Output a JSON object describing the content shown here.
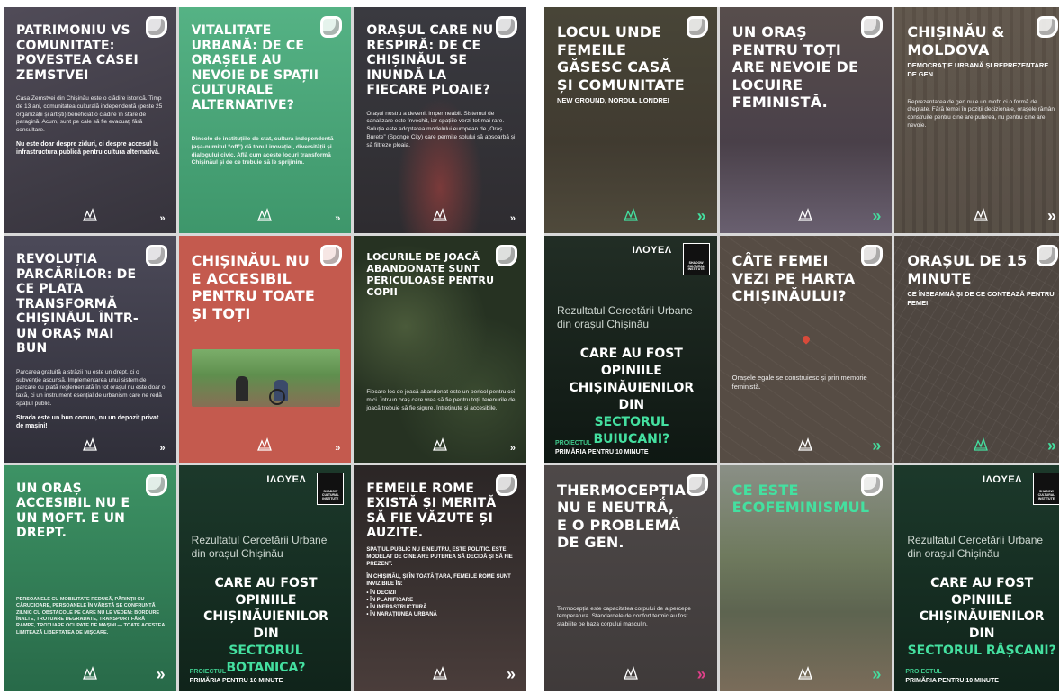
{
  "left_panel": {
    "tiles": [
      {
        "title": "PATRIMONIU VS COMUNITATE: POVESTEA CASEI ZEMSTVEI",
        "body": "Casa Zemstvei din Chișinău este o clădire istorică. Timp de 13 ani, comunitatea culturală independentă (peste 25 organizații și artiști) beneficiat o clădire în stare de paragină. Acum, sunt pe cale să fie evacuați fără consultare.",
        "strong": "Nu este doar despre ziduri, ci despre accesul la infrastructura publică pentru cultura alternativă.",
        "arrow": "»",
        "bg": "#4a4650"
      },
      {
        "title": "VITALITATE URBANĂ: DE CE ORAȘELE AU NEVOIE DE SPAȚII CULTURALE ALTERNATIVE?",
        "body": "Dincolo de instituțiile de stat, cultura independentă (așa-numitul “off”) dă tonul inovației, diversității și dialogului civic. Află cum aceste locuri transformă Chișinăul și de ce trebuie să le sprijinim.",
        "arrow": "»",
        "bg": "#4cae7e"
      },
      {
        "title": "ORAȘUL CARE NU RESPIRĂ: DE CE CHIȘINĂUL SE INUNDĂ LA FIECARE PLOAIE?",
        "body": "Orașul nostru a devenit impermeabil. Sistemul de canalizare este învechit, iar spațiile verzi tot mai rare. Soluția este adoptarea modelului european de „Oraș Burete” (Sponge City) care permite solului să absoarbă și să filtreze ploaia.",
        "arrow": "»",
        "bg": "#3e3d45"
      },
      {
        "title": "REVOLUȚIA PARCĂRILOR: DE CE PLATA TRANSFORMĂ CHIȘINĂUL ÎNTR-UN ORAȘ MAI BUN",
        "body": "Parcarea gratuită a străzii nu este un drept, ci o subvenție ascunsă. Implementarea unui sistem de parcare cu plată reglementată în tot orașul nu este doar o taxă, ci un instrument esențial de urbanism care ne redă spațiul public.",
        "strong": "Strada este un bun comun, nu un depozit privat de mașini!",
        "arrow": "»",
        "bg": "#4a4856"
      },
      {
        "title": "CHIȘINĂUL NU E ACCESIBIL PENTRU TOATE ȘI TOȚI",
        "arrow": "»",
        "bg": "#c45a4e"
      },
      {
        "title": "LOCURILE DE JOACĂ ABANDONATE SUNT PERICULOASE PENTRU COPII",
        "body": "Fiecare loc de joacă abandonat este un pericol pentru cei mici. Într-un oraș care vrea să fie pentru toți, terenurile de joacă trebuie să fie sigure, întreținute și accesibile.",
        "arrow": "»",
        "bg": "#2f3c2c"
      },
      {
        "title": "UN ORAȘ ACCESIBIL NU E UN MOFT. E UN DREPT.",
        "body": "PERSOANELE CU MOBILITATE REDUSĂ, PĂRINȚII CU CĂRUCIOARE, PERSOANELE ÎN VÂRSTĂ SE CONFRUNTĂ ZILNIC CU OBSTACOLE PE CARE NU LE VEDEM: BORDURE ÎNALTE, TROTUARE DEGRADATE, TRANSPORT FĂRĂ RAMPE, TROTUARE OCUPATE DE MAȘINI — TOATE ACESTEA LIMITEAZĂ LIBERTATEA DE MIȘCARE.",
        "arrow": "»",
        "bg": "#3f8e66"
      },
      {
        "survey": true,
        "brand": "ΙΛOΥΕΛ",
        "badge": "SHADOW CULTURAL INSTITUTE",
        "kicker": "Rezultatul Cercetării Urbane din orașul Chișinău",
        "question": "CARE AU FOST OPINIILE CHIȘINĂUIENILOR DIN",
        "sector": "SECTORUL BOTANICA?",
        "foot1": "PROIECTUL",
        "foot2": "PRIMĂRIA PENTRU 10 MINUTE",
        "bg": "#1e3d2e"
      },
      {
        "title": "FEMEILE ROME EXISTĂ ȘI MERITĂ SĂ FIE VĂZUTE ȘI AUZITE.",
        "body": "SPAȚIUL PUBLIC NU E NEUTRU, ESTE POLITIC. ESTE MODELAT DE CINE ARE PUTEREA SĂ DECIDĂ ȘI SĂ FIE PREZENT.",
        "list_intro": "ÎN CHIȘINĂU, ȘI ÎN TOATĂ ȚARA, FEMEILE ROME SUNT INVIZIBILE ÎN:",
        "list": [
          "• ÎN DECIZII",
          "• ÎN PLANIFICARE",
          "• ÎN INFRASTRUCTURĂ",
          "• ÎN NARAȚIUNEA URBANĂ"
        ],
        "arrow": "»",
        "bg": "#3a3434"
      }
    ]
  },
  "right_panel": {
    "tiles": [
      {
        "title": "LOCUL UNDE FEMEILE GĂSESC CASĂ ȘI COMUNITATE",
        "subtitle": "NEW GROUND, NORDUL LONDREI",
        "arrow": "»",
        "arrow_color": "teal",
        "bg": "#4b4438"
      },
      {
        "title": "UN ORAȘ PENTRU TOȚI ARE NEVOIE DE LOCUIRE FEMINISTĂ.",
        "arrow": "»",
        "arrow_color": "teal",
        "bg": "#534a45"
      },
      {
        "title": "CHIȘINĂU & MOLDOVA",
        "subtitle": "DEMOCRAȚIE URBANĂ ȘI REPREZENTARE DE GEN",
        "body": "Reprezentarea de gen nu e un mofт, ci o formă de dreptate. Fără femei în poziții decizionale, orașele rămân construite pentru cine are puterea, nu pentru cine are nevoie.",
        "arrow": "»",
        "arrow_color": "white",
        "bg": "#5a5046"
      },
      {
        "survey": true,
        "brand": "ΙΛOΥΕΛ",
        "badge": "SHADOW CULTURAL INSTITUTE",
        "kicker": "Rezultatul Cercetării Urbane din orașul Chișinău",
        "question": "CARE AU FOST OPINIILE CHIȘINĂUIENILOR DIN",
        "sector": "SECTORUL BUIUCANI?",
        "foot1": "PROIECTUL",
        "foot2": "PRIMĂRIA PENTRU 10 MINUTE",
        "bg": "#1f2c24"
      },
      {
        "title": "CÂTE FEMEI VEZI PE HARTA CHIȘINĂULUI?",
        "body": "Orașele egale se construiesc și prin memorie feministă.",
        "arrow": "»",
        "arrow_color": "teal",
        "bg": "#564c44"
      },
      {
        "title": "ORAȘUL DE 15 MINUTE",
        "subtitle": "CE ÎNSEAMNĂ ȘI DE CE CONTEAZĂ PENTRU FEMEI",
        "arrow": "»",
        "arrow_color": "teal",
        "bg": "#4e4640"
      },
      {
        "title": "THERMOCEPȚIA NU E NEUTRĂ, E O PROBLEMĂ DE GEN.",
        "body": "Termocepția este capacitatea corpului de a percepe temperatura. Standardele de confort termic au fost stabilite pe baza corpului masculin.",
        "arrow": "»",
        "arrow_color": "pink",
        "bg": "#4b4645"
      },
      {
        "title": "CE ESTE ECOFEMINISMUL",
        "arrow": "»",
        "arrow_color": "teal",
        "bg": "#6d6a5a"
      },
      {
        "survey": true,
        "brand": "ΙΛOΥΕΛ",
        "badge": "SHADOW CULTURAL INSTITUTE",
        "kicker": "Rezultatul Cercetării Urbane din orașul Chișinău",
        "question": "CARE AU FOST OPINIILE CHIȘINĂUIENILOR DIN",
        "sector": "SECTORUL RÂȘCANI?",
        "foot1": "PROIECTUL",
        "foot2": "PRIMĂRIA PENTRU 10 MINUTE",
        "bg": "#1e3d2e"
      }
    ]
  },
  "colors": {
    "accent_teal": "#44e0a0",
    "accent_pink": "#e0408a",
    "tile_green": "#4cae7e",
    "tile_red": "#c45a4e"
  },
  "icons": {
    "bubble": "speech-bubble-icon",
    "logo": "org-logo-icon",
    "arrow": "double-chevron-right-icon"
  }
}
